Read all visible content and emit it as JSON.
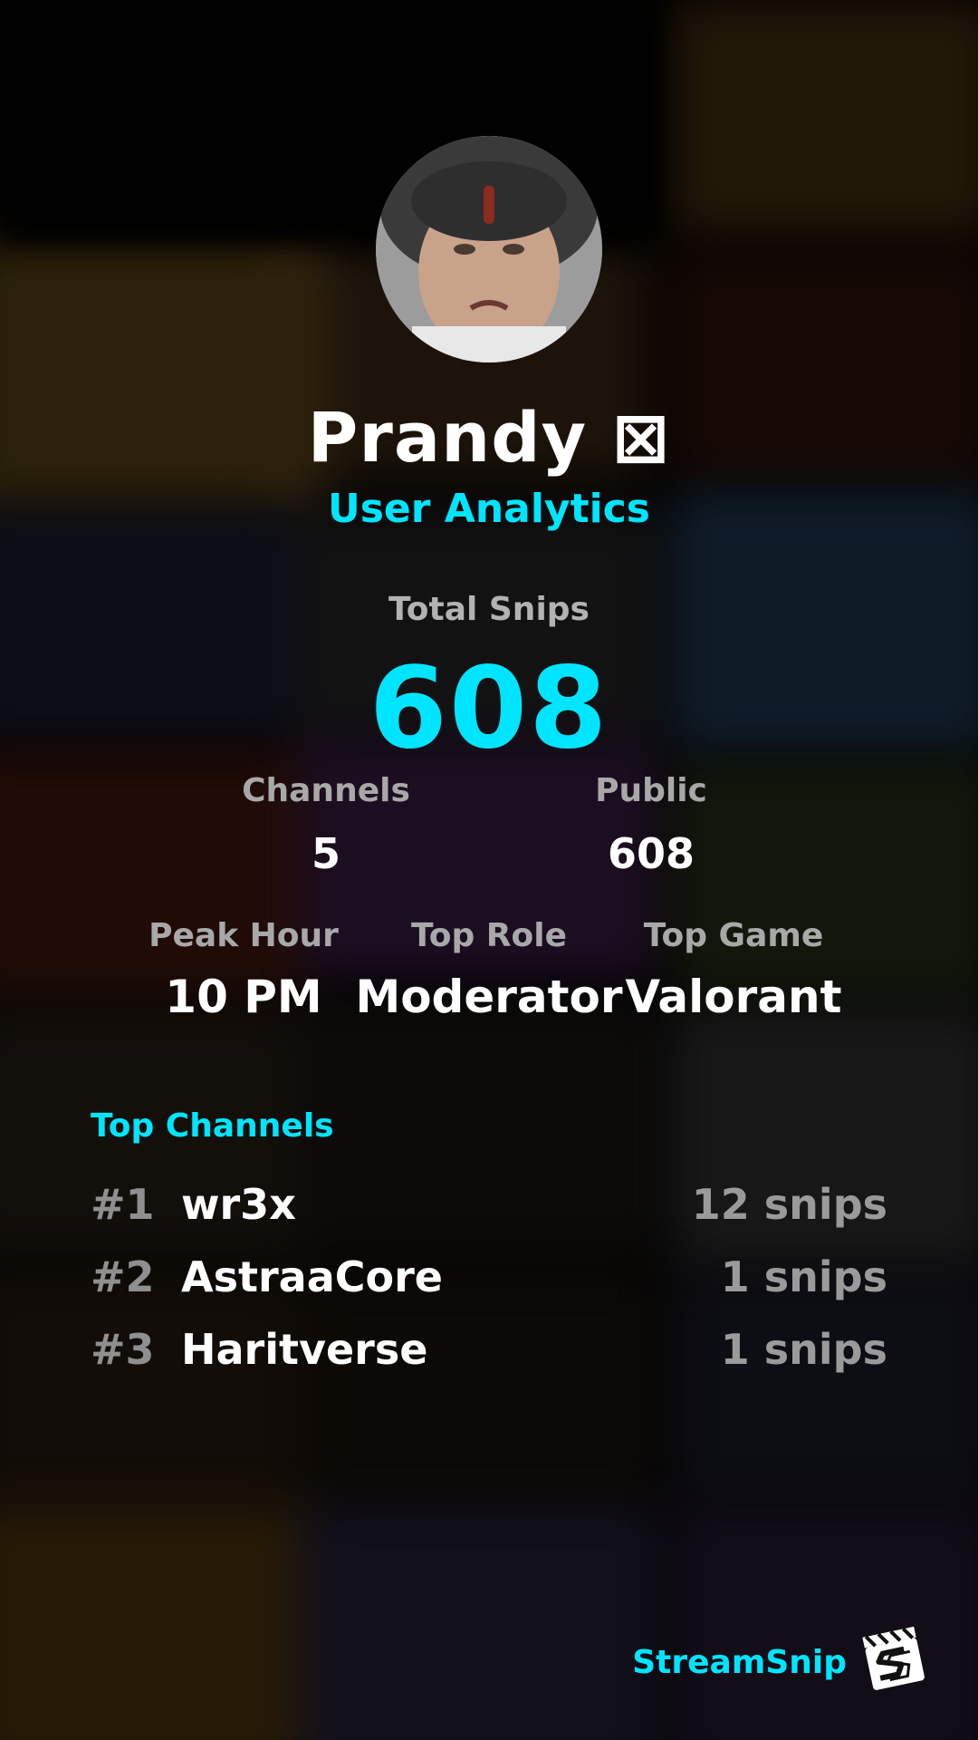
{
  "profile": {
    "name": "Prandy",
    "name_badge": "⊠",
    "subtitle": "User Analytics"
  },
  "totals": {
    "label": "Total Snips",
    "value": "608"
  },
  "stats_row_1": [
    {
      "label": "Channels",
      "value": "5"
    },
    {
      "label": "Public",
      "value": "608"
    }
  ],
  "stats_row_2": [
    {
      "label": "Peak Hour",
      "value": "10 PM"
    },
    {
      "label": "Top Role",
      "value": "Moderator"
    },
    {
      "label": "Top Game",
      "value": "Valorant"
    }
  ],
  "top_channels": {
    "title": "Top Channels",
    "items": [
      {
        "rank": "#1",
        "name": "wr3x",
        "count": "12 snips"
      },
      {
        "rank": "#2",
        "name": "AstraaCore",
        "count": "1 snips"
      },
      {
        "rank": "#3",
        "name": "Haritverse",
        "count": "1 snips"
      }
    ]
  },
  "brand": {
    "name": "StreamSnip",
    "logo_icon": "clapperboard-s-icon"
  },
  "colors": {
    "accent": "#00e5ff",
    "background": "#000000",
    "muted_label": "#a8a8a8"
  }
}
